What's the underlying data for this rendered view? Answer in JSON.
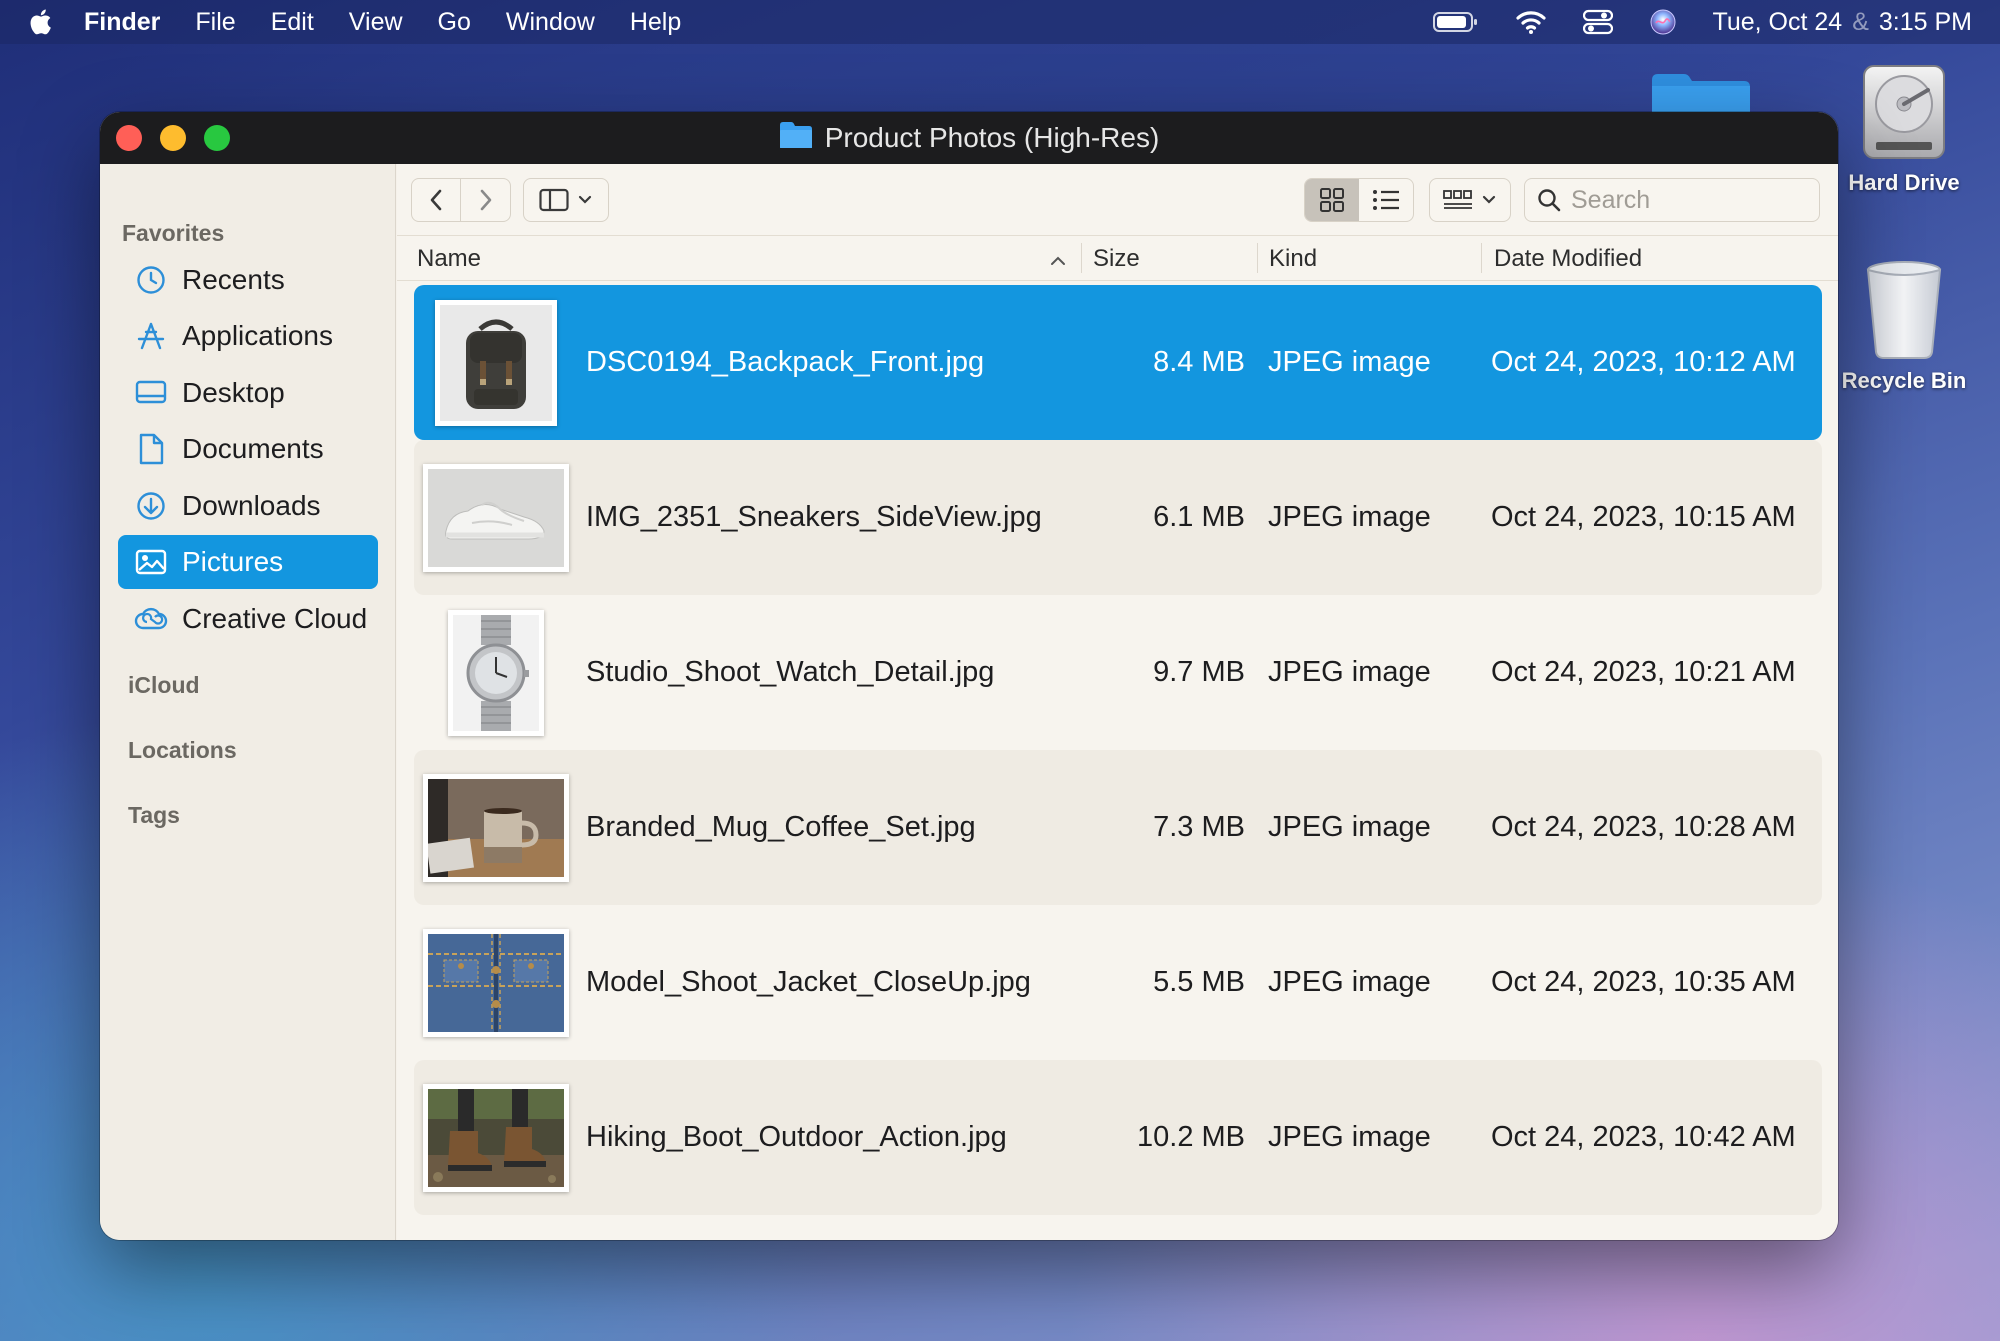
{
  "menubar": {
    "app_name": "Finder",
    "items": [
      "File",
      "Edit",
      "View",
      "Go",
      "Window",
      "Help"
    ],
    "date": "Tue, Oct 24",
    "date_separator": "&",
    "time": "3:15 PM"
  },
  "desktop": {
    "hard_drive_label": "Hard Drive",
    "recycle_bin_label": "Recycle Bin"
  },
  "window": {
    "title": "Product Photos (High-Res)"
  },
  "sidebar": {
    "favorites_header": "Favorites",
    "items": [
      {
        "label": "Recents",
        "icon": "clock-icon"
      },
      {
        "label": "Applications",
        "icon": "applications-icon"
      },
      {
        "label": "Desktop",
        "icon": "desktop-icon"
      },
      {
        "label": "Documents",
        "icon": "document-icon"
      },
      {
        "label": "Downloads",
        "icon": "download-icon"
      },
      {
        "label": "Pictures",
        "icon": "pictures-icon",
        "selected": true
      },
      {
        "label": "Creative Cloud",
        "icon": "creative-cloud-icon"
      }
    ],
    "icloud_header": "iCloud",
    "locations_header": "Locations",
    "tags_header": "Tags"
  },
  "toolbar": {
    "search_placeholder": "Search"
  },
  "columns": {
    "name": "Name",
    "size": "Size",
    "kind": "Kind",
    "date_modified": "Date Modified",
    "sort": "name-ascending"
  },
  "files": [
    {
      "name": "DSC0194_Backpack_Front.jpg",
      "size": "8.4 MB",
      "kind": "JPEG image",
      "date": "Oct 24, 2023, 10:12 AM",
      "thumbnail": "backpack",
      "selected": true
    },
    {
      "name": "IMG_2351_Sneakers_SideView.jpg",
      "size": "6.1 MB",
      "kind": "JPEG image",
      "date": "Oct 24, 2023, 10:15 AM",
      "thumbnail": "sneakers"
    },
    {
      "name": "Studio_Shoot_Watch_Detail.jpg",
      "size": "9.7 MB",
      "kind": "JPEG image",
      "date": "Oct 24, 2023, 10:21 AM",
      "thumbnail": "watch"
    },
    {
      "name": "Branded_Mug_Coffee_Set.jpg",
      "size": "7.3 MB",
      "kind": "JPEG image",
      "date": "Oct 24, 2023, 10:28 AM",
      "thumbnail": "mug"
    },
    {
      "name": "Model_Shoot_Jacket_CloseUp.jpg",
      "size": "5.5 MB",
      "kind": "JPEG image",
      "date": "Oct 24, 2023, 10:35 AM",
      "thumbnail": "denim-jacket"
    },
    {
      "name": "Hiking_Boot_Outdoor_Action.jpg",
      "size": "10.2 MB",
      "kind": "JPEG image",
      "date": "Oct 24, 2023, 10:42 AM",
      "thumbnail": "hiking-boots"
    }
  ],
  "colors": {
    "selection": "#1396df",
    "titlebar": "#1c1c1e",
    "window_bg": "#f5f1ea"
  }
}
